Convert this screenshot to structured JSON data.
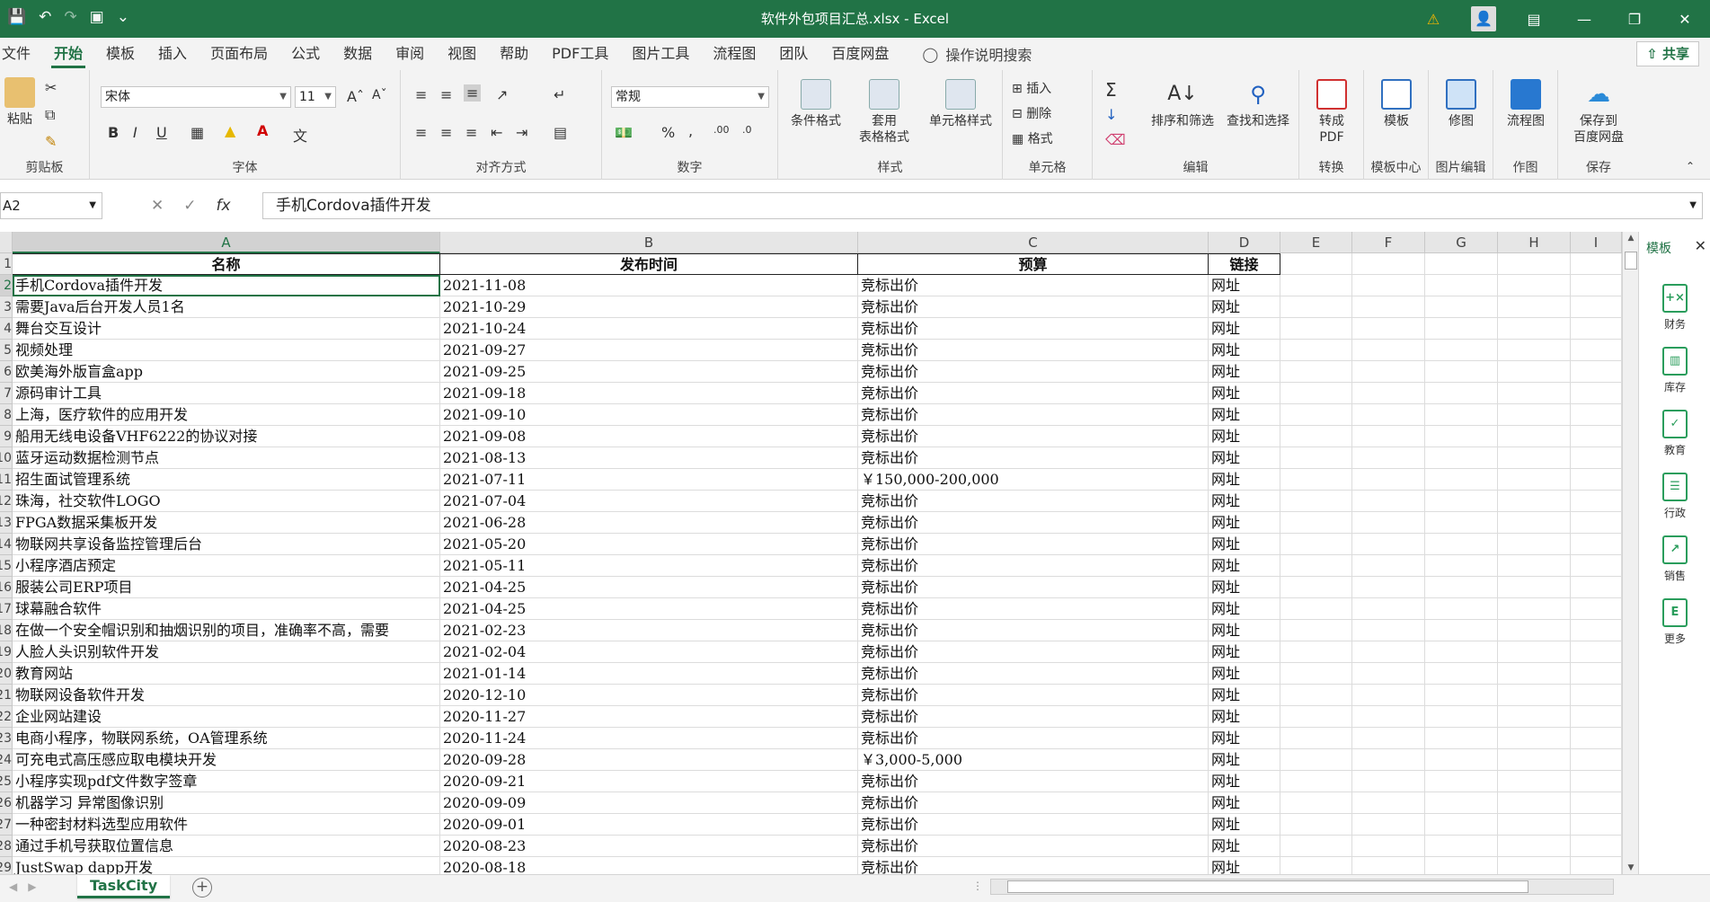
{
  "window": {
    "title": "软件外包项目汇总.xlsx  -  Excel"
  },
  "menu": {
    "tabs": [
      "文件",
      "开始",
      "模板",
      "插入",
      "页面布局",
      "公式",
      "数据",
      "审阅",
      "视图",
      "帮助",
      "PDF工具",
      "图片工具",
      "流程图",
      "团队",
      "百度网盘"
    ],
    "active_tab": "开始",
    "search_label": "操作说明搜索",
    "share_label": "共享"
  },
  "ribbon": {
    "clipboard": {
      "paste": "粘贴",
      "label": "剪贴板"
    },
    "font": {
      "name": "宋体",
      "size": "11",
      "label": "字体"
    },
    "alignment": {
      "label": "对齐方式"
    },
    "number": {
      "format": "常规",
      "label": "数字"
    },
    "styles": {
      "conditional": "条件格式",
      "table_format_1": "套用",
      "table_format_2": "表格格式",
      "cell_styles": "单元格样式",
      "label": "样式"
    },
    "cells": {
      "insert": "插入",
      "delete": "删除",
      "format": "格式",
      "label": "单元格"
    },
    "editing": {
      "sort_filter": "排序和筛选",
      "find_select": "查找和选择",
      "label": "编辑"
    },
    "convert": {
      "to_pdf_1": "转成",
      "to_pdf_2": "PDF",
      "label": "转换"
    },
    "template": {
      "btn": "模板",
      "label": "模板中心"
    },
    "image": {
      "btn": "修图",
      "label": "图片编辑"
    },
    "drawing": {
      "btn": "流程图",
      "label": "作图"
    },
    "save": {
      "btn_1": "保存到",
      "btn_2": "百度网盘",
      "label": "保存"
    }
  },
  "formula_bar": {
    "name_box": "A2",
    "fx": "fx",
    "content": "手机Cordova插件开发"
  },
  "columns": [
    "A",
    "B",
    "C",
    "D",
    "E",
    "F",
    "G",
    "H",
    "I"
  ],
  "header_row": {
    "row_num": "1",
    "cells": [
      "名称",
      "发布时间",
      "预算",
      "链接"
    ]
  },
  "rows": [
    {
      "row_num": "2",
      "name": "手机Cordova插件开发",
      "date": "2021-11-08",
      "budget": "竞标出价",
      "link": "网址"
    },
    {
      "row_num": "3",
      "name": "需要Java后台开发人员1名",
      "date": "2021-10-29",
      "budget": "竞标出价",
      "link": "网址"
    },
    {
      "row_num": "4",
      "name": "舞台交互设计",
      "date": "2021-10-24",
      "budget": "竞标出价",
      "link": "网址"
    },
    {
      "row_num": "5",
      "name": "视频处理",
      "date": "2021-09-27",
      "budget": "竞标出价",
      "link": "网址"
    },
    {
      "row_num": "6",
      "name": "欧美海外版盲盒app",
      "date": "2021-09-25",
      "budget": "竞标出价",
      "link": "网址"
    },
    {
      "row_num": "7",
      "name": "源码审计工具",
      "date": "2021-09-18",
      "budget": "竞标出价",
      "link": "网址"
    },
    {
      "row_num": "8",
      "name": "上海，医疗软件的应用开发",
      "date": "2021-09-10",
      "budget": "竞标出价",
      "link": "网址"
    },
    {
      "row_num": "9",
      "name": "船用无线电设备VHF6222的协议对接",
      "date": "2021-09-08",
      "budget": "竞标出价",
      "link": "网址"
    },
    {
      "row_num": "10",
      "name": "蓝牙运动数据检测节点",
      "date": "2021-08-13",
      "budget": "竞标出价",
      "link": "网址"
    },
    {
      "row_num": "11",
      "name": "招生面试管理系统",
      "date": "2021-07-11",
      "budget": "￥150,000-200,000",
      "link": "网址"
    },
    {
      "row_num": "12",
      "name": "珠海，社交软件LOGO",
      "date": "2021-07-04",
      "budget": "竞标出价",
      "link": "网址"
    },
    {
      "row_num": "13",
      "name": "FPGA数据采集板开发",
      "date": "2021-06-28",
      "budget": "竞标出价",
      "link": "网址"
    },
    {
      "row_num": "14",
      "name": "物联网共享设备监控管理后台",
      "date": "2021-05-20",
      "budget": "竞标出价",
      "link": "网址"
    },
    {
      "row_num": "15",
      "name": "小程序酒店预定",
      "date": "2021-05-11",
      "budget": "竞标出价",
      "link": "网址"
    },
    {
      "row_num": "16",
      "name": "服装公司ERP项目",
      "date": "2021-04-25",
      "budget": "竞标出价",
      "link": "网址"
    },
    {
      "row_num": "17",
      "name": "球幕融合软件",
      "date": "2021-04-25",
      "budget": "竞标出价",
      "link": "网址"
    },
    {
      "row_num": "18",
      "name": "在做一个安全帽识别和抽烟识别的项目，准确率不高，需要",
      "date": "2021-02-23",
      "budget": "竞标出价",
      "link": "网址"
    },
    {
      "row_num": "19",
      "name": "人脸人头识别软件开发",
      "date": "2021-02-04",
      "budget": "竞标出价",
      "link": "网址"
    },
    {
      "row_num": "20",
      "name": "教育网站",
      "date": "2021-01-14",
      "budget": "竞标出价",
      "link": "网址"
    },
    {
      "row_num": "21",
      "name": "物联网设备软件开发",
      "date": "2020-12-10",
      "budget": "竞标出价",
      "link": "网址"
    },
    {
      "row_num": "22",
      "name": "企业网站建设",
      "date": "2020-11-27",
      "budget": "竞标出价",
      "link": "网址"
    },
    {
      "row_num": "23",
      "name": "电商小程序，物联网系统，OA管理系统",
      "date": "2020-11-24",
      "budget": "竞标出价",
      "link": "网址"
    },
    {
      "row_num": "24",
      "name": "可充电式高压感应取电模块开发",
      "date": "2020-09-28",
      "budget": "￥3,000-5,000",
      "link": "网址"
    },
    {
      "row_num": "25",
      "name": "小程序实现pdf文件数字签章",
      "date": "2020-09-21",
      "budget": "竞标出价",
      "link": "网址"
    },
    {
      "row_num": "26",
      "name": "机器学习 异常图像识别",
      "date": "2020-09-09",
      "budget": "竞标出价",
      "link": "网址"
    },
    {
      "row_num": "27",
      "name": "一种密封材料选型应用软件",
      "date": "2020-09-01",
      "budget": "竞标出价",
      "link": "网址"
    },
    {
      "row_num": "28",
      "name": "通过手机号获取位置信息",
      "date": "2020-08-23",
      "budget": "竞标出价",
      "link": "网址"
    },
    {
      "row_num": "29",
      "name": "JustSwap dapp开发",
      "date": "2020-08-18",
      "budget": "竞标出价",
      "link": "网址"
    }
  ],
  "side_pane": {
    "title": "模板",
    "items": [
      "财务",
      "库存",
      "教育",
      "行政",
      "销售",
      "更多"
    ]
  },
  "sheet_tabs": [
    "TaskCity"
  ],
  "colors": {
    "excel_green": "#217346"
  }
}
